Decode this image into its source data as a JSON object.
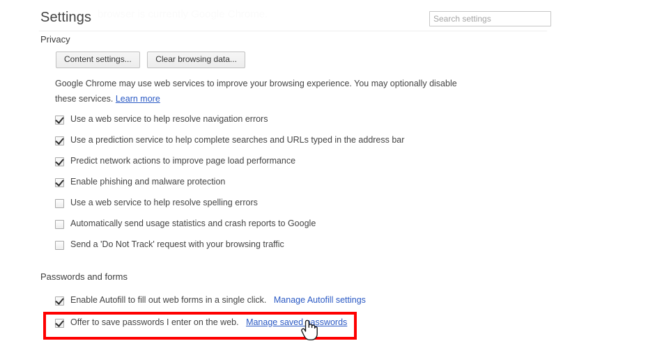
{
  "header": {
    "title": "Settings",
    "ghost_text": "browser is currently Google Chrome.",
    "search_placeholder": "Search settings",
    "search_value": ""
  },
  "privacy": {
    "section_title": "Privacy",
    "buttons": [
      {
        "label": "Content settings..."
      },
      {
        "label": "Clear browsing data..."
      }
    ],
    "description": "Google Chrome may use web services to improve your browsing experience. You may optionally disable these services.",
    "learn_more_label": "Learn more",
    "options": [
      {
        "label": "Use a web service to help resolve navigation errors",
        "checked": true
      },
      {
        "label": "Use a prediction service to help complete searches and URLs typed in the address bar",
        "checked": true
      },
      {
        "label": "Predict network actions to improve page load performance",
        "checked": true
      },
      {
        "label": "Enable phishing and malware protection",
        "checked": true
      },
      {
        "label": "Use a web service to help resolve spelling errors",
        "checked": false
      },
      {
        "label": "Automatically send usage statistics and crash reports to Google",
        "checked": false
      },
      {
        "label": "Send a 'Do Not Track' request with your browsing traffic",
        "checked": false
      }
    ]
  },
  "passwords_and_forms": {
    "section_title": "Passwords and forms",
    "autofill": {
      "label": "Enable Autofill to fill out web forms in a single click.",
      "link_label": "Manage Autofill settings",
      "checked": true
    },
    "save_passwords": {
      "label": "Offer to save passwords I enter on the web.",
      "link_label": "Manage saved passwords",
      "checked": true,
      "link_hovered": true
    }
  },
  "annotation": {
    "highlight_color": "#fe0000",
    "cursor_type": "pointer-hand"
  }
}
